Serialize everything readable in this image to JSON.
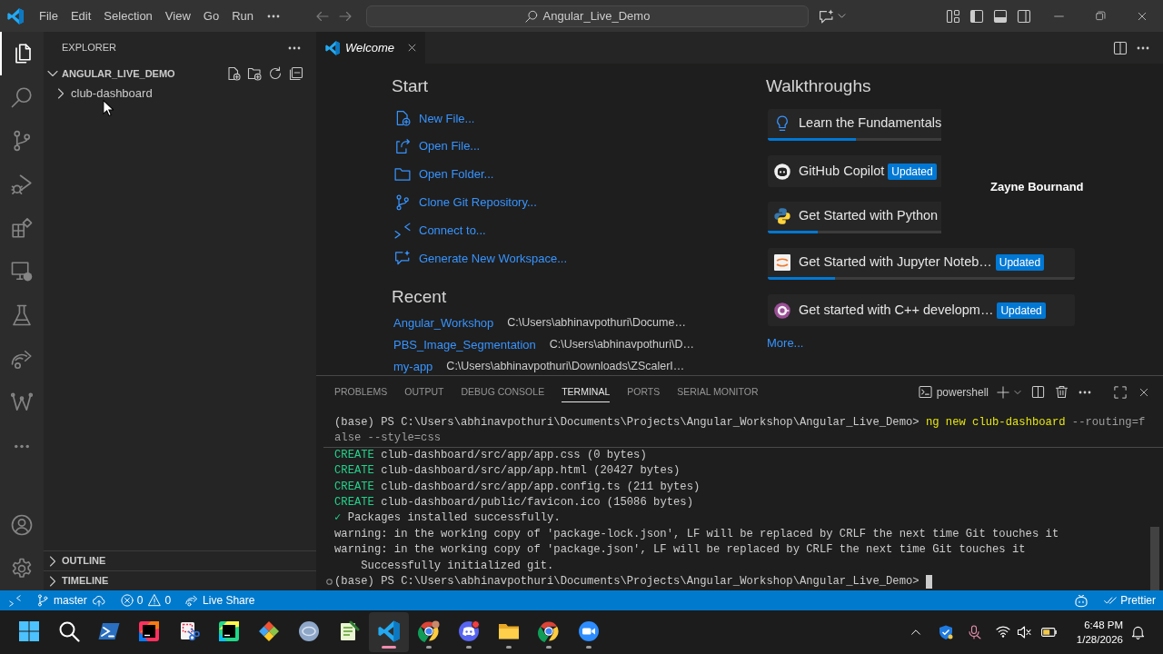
{
  "title_bar": {
    "menu": [
      "File",
      "Edit",
      "Selection",
      "View",
      "Go",
      "Run"
    ],
    "search": "Angular_Live_Demo"
  },
  "activity_bar": {
    "items": [
      {
        "kind": "explorer",
        "selected": true
      },
      {
        "kind": "search",
        "selected": false
      },
      {
        "kind": "source-control",
        "selected": false
      },
      {
        "kind": "run",
        "selected": false
      },
      {
        "kind": "extensions",
        "selected": false
      },
      {
        "kind": "remote",
        "selected": false
      },
      {
        "kind": "testing",
        "selected": false
      },
      {
        "kind": "live-share",
        "selected": false
      },
      {
        "kind": "graph",
        "selected": false
      },
      {
        "kind": "more",
        "selected": false
      }
    ],
    "bottom": [
      {
        "kind": "accounts"
      },
      {
        "kind": "manage"
      }
    ]
  },
  "sidebar": {
    "title": "EXPLORER",
    "tree": [
      {
        "label": "ANGULAR_LIVE_DEMO",
        "expanded": true,
        "children": [
          {
            "label": "club-dashboard",
            "expanded": false
          }
        ]
      }
    ],
    "sections": [
      {
        "label": "OUTLINE",
        "expanded": false
      },
      {
        "label": "TIMELINE",
        "expanded": false
      }
    ]
  },
  "editor": {
    "tabs": [
      {
        "label": "Welcome",
        "selected": true
      }
    ],
    "welcome": {
      "start": {
        "heading": "Start",
        "items": [
          {
            "kind": "new-file",
            "label": "New File..."
          },
          {
            "kind": "open-file",
            "label": "Open File..."
          },
          {
            "kind": "open-folder",
            "label": "Open Folder..."
          },
          {
            "kind": "clone",
            "label": "Clone Git Repository..."
          },
          {
            "kind": "connect",
            "label": "Connect to..."
          },
          {
            "kind": "generate",
            "label": "Generate New Workspace..."
          }
        ]
      },
      "recent": {
        "heading": "Recent",
        "items": [
          {
            "name": "Angular_Workshop",
            "path": "C:\\Users\\abhinavpothuri\\Docume…"
          },
          {
            "name": "PBS_Image_Segmentation",
            "path": "C:\\Users\\abhinavpothuri\\D…"
          },
          {
            "name": "my-app",
            "path": "C:\\Users\\abhinavpothuri\\Downloads\\ZScalerI…"
          }
        ]
      },
      "walkthroughs": {
        "heading": "Walkthroughs",
        "items": [
          {
            "kind": "bulb",
            "title": "Learn the Fundamentals",
            "level": 0.51
          },
          {
            "kind": "copilot",
            "title": "GitHub Copilot",
            "badge": "Updated"
          },
          {
            "kind": "python",
            "title": "Get Started with Python",
            "level": 0.29
          },
          {
            "kind": "jupyter",
            "title": "Get Started with Jupyter Noteb…",
            "badge": "Updated",
            "level": 0.22
          },
          {
            "kind": "cpp",
            "title": "Get started with C++ developm…",
            "badge": "Updated"
          }
        ],
        "more": "More..."
      }
    }
  },
  "video_overlay": {
    "name": "Zayne Bournand"
  },
  "panel": {
    "tabs": [
      {
        "label": "PROBLEMS",
        "selected": false
      },
      {
        "label": "OUTPUT",
        "selected": false
      },
      {
        "label": "DEBUG CONSOLE",
        "selected": false
      },
      {
        "label": "TERMINAL",
        "selected": true
      },
      {
        "label": "PORTS",
        "selected": false
      },
      {
        "label": "SERIAL MONITOR",
        "selected": false
      }
    ],
    "terminal_name": "powershell",
    "terminal": {
      "sticky": [
        [
          {
            "kind": "plain",
            "text": "(base) PS C:\\Users\\abhinavpothuri\\Documents\\Projects\\Angular_Workshop\\Angular_Live_Demo> "
          },
          {
            "kind": "command",
            "text": "ng new club-dashboard"
          },
          {
            "kind": "arg",
            "text": " --routing=f"
          }
        ],
        [
          {
            "kind": "arg",
            "text": "alse --style=css"
          }
        ]
      ],
      "lines": [
        [
          {
            "kind": "success",
            "text": "CREATE"
          },
          {
            "kind": "plain",
            "text": " club-dashboard/src/app/app.css (0 bytes)"
          }
        ],
        [
          {
            "kind": "success",
            "text": "CREATE"
          },
          {
            "kind": "plain",
            "text": " club-dashboard/src/app/app.html (20427 bytes)"
          }
        ],
        [
          {
            "kind": "success",
            "text": "CREATE"
          },
          {
            "kind": "plain",
            "text": " club-dashboard/src/app/app.config.ts (211 bytes)"
          }
        ],
        [
          {
            "kind": "success",
            "text": "CREATE"
          },
          {
            "kind": "plain",
            "text": " club-dashboard/public/favicon.ico (15086 bytes)"
          }
        ],
        [
          {
            "kind": "success",
            "text": "✓"
          },
          {
            "kind": "plain",
            "text": " Packages installed successfully."
          }
        ],
        [
          {
            "kind": "plain",
            "text": "warning: in the working copy of 'package-lock.json', LF will be replaced by CRLF the next time Git touches it"
          }
        ],
        [
          {
            "kind": "plain",
            "text": "warning: in the working copy of 'package.json', LF will be replaced by CRLF the next time Git touches it"
          }
        ],
        [
          {
            "kind": "plain",
            "text": "    Successfully initialized git."
          }
        ]
      ],
      "prompt": {
        "text": "(base) PS C:\\Users\\abhinavpothuri\\Documents\\Projects\\Angular_Workshop\\Angular_Live_Demo>",
        "decorated": true,
        "cursor": true
      }
    }
  },
  "status_bar": {
    "branch": "master",
    "errors": "0",
    "warnings": "0",
    "live_share": "Live Share",
    "formatter": "Prettier"
  },
  "taskbar": {
    "apps": [
      {
        "kind": "start",
        "running": false,
        "active": false
      },
      {
        "kind": "search",
        "running": false,
        "active": false
      },
      {
        "kind": "terminal",
        "running": false,
        "active": false
      },
      {
        "kind": "tile-a",
        "running": false,
        "active": false
      },
      {
        "kind": "snip",
        "running": false,
        "active": false
      },
      {
        "kind": "tile-b",
        "running": false,
        "active": false
      },
      {
        "kind": "diamond",
        "running": false,
        "active": false
      },
      {
        "kind": "circle",
        "running": false,
        "active": false
      },
      {
        "kind": "notepad",
        "running": false,
        "active": false
      },
      {
        "kind": "editor",
        "running": true,
        "active": true
      },
      {
        "kind": "browser-avatar",
        "running": true,
        "active": false
      },
      {
        "kind": "chat",
        "running": true,
        "active": false
      },
      {
        "kind": "folder",
        "running": true,
        "active": false
      },
      {
        "kind": "browser",
        "running": true,
        "active": false
      },
      {
        "kind": "video",
        "running": true,
        "active": false
      }
    ],
    "time": "6:48 PM",
    "date": "1/28/2026"
  }
}
